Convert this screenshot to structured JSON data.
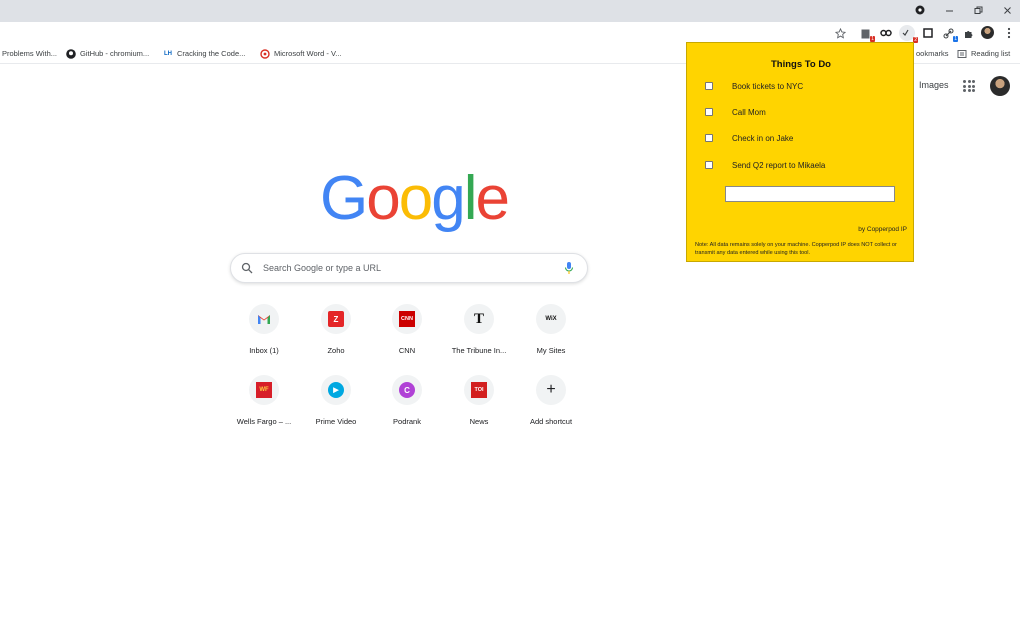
{
  "bookmarks": [
    {
      "label": "Problems With...",
      "icon": "none"
    },
    {
      "label": "GitHub - chromium...",
      "icon": "github-icon"
    },
    {
      "label": "Cracking the Code...",
      "icon": "linkedin-icon"
    },
    {
      "label": "Microsoft Word - V...",
      "icon": "pdf-icon"
    }
  ],
  "bookmarks_right": {
    "all_bookmarks": "ookmarks",
    "reading_list": "Reading list"
  },
  "header": {
    "images": "Images"
  },
  "logo": {
    "letters": [
      "G",
      "o",
      "o",
      "g",
      "l",
      "e"
    ],
    "colors": [
      "#4285f4",
      "#ea4335",
      "#fbbc05",
      "#4285f4",
      "#34a853",
      "#ea4335"
    ]
  },
  "search": {
    "placeholder": "Search Google or type a URL"
  },
  "shortcuts": [
    {
      "label": "Inbox (1)",
      "icon": "gmail-icon",
      "fav": "M",
      "bg": "#ffffff",
      "fg": "#ea4335"
    },
    {
      "label": "Zoho",
      "icon": "zoho-icon",
      "fav": "Z",
      "bg": "#e42527",
      "fg": "#ffffff"
    },
    {
      "label": "CNN",
      "icon": "cnn-icon",
      "fav": "CNN",
      "bg": "#cc0000",
      "fg": "#ffffff"
    },
    {
      "label": "The Tribune In...",
      "icon": "tribune-icon",
      "fav": "T",
      "bg": "transparent",
      "fg": "#111111"
    },
    {
      "label": "My Sites",
      "icon": "wix-icon",
      "fav": "WiX",
      "bg": "transparent",
      "fg": "#111111"
    },
    {
      "label": "Wells Fargo – ...",
      "icon": "wells-fargo-icon",
      "fav": "WF",
      "bg": "#d71e28",
      "fg": "#ffcd41"
    },
    {
      "label": "Prime Video",
      "icon": "prime-video-icon",
      "fav": "▶",
      "bg": "#00a8e1",
      "fg": "#ffffff"
    },
    {
      "label": "Podrank",
      "icon": "podrank-icon",
      "fav": "C",
      "bg": "#b042d6",
      "fg": "#ffffff"
    },
    {
      "label": "News",
      "icon": "toi-icon",
      "fav": "TOI",
      "bg": "#d21f1f",
      "fg": "#ffffff"
    },
    {
      "label": "Add shortcut",
      "icon": "plus-icon",
      "fav": "+",
      "bg": "transparent",
      "fg": "#202124"
    }
  ],
  "popup": {
    "title": "Things To Do",
    "tasks": [
      "Book tickets to NYC",
      "Call Mom",
      "Check in on Jake",
      "Send Q2 report to Mikaela"
    ],
    "credit": "by Copperpod IP",
    "note": "Note: All data remains solely on your machine. Copperpod IP does NOT collect or transmit any data entered while using this tool.",
    "accent": "#ffd400"
  }
}
